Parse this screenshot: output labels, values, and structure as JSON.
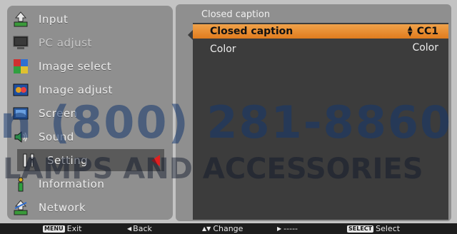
{
  "sidebar": {
    "items": [
      {
        "label": "Input",
        "icon": "input-icon"
      },
      {
        "label": "PC adjust",
        "icon": "pc-adjust-icon"
      },
      {
        "label": "Image select",
        "icon": "image-select-icon"
      },
      {
        "label": "Image adjust",
        "icon": "image-adjust-icon"
      },
      {
        "label": "Screen",
        "icon": "screen-icon"
      },
      {
        "label": "Sound",
        "icon": "sound-icon"
      },
      {
        "label": "Setting",
        "icon": "setting-icon"
      },
      {
        "label": "Information",
        "icon": "information-icon"
      },
      {
        "label": "Network",
        "icon": "network-icon"
      }
    ]
  },
  "panel": {
    "header": "Closed caption",
    "rows": [
      {
        "label": "Closed caption",
        "value": "CC1"
      },
      {
        "label": "Color",
        "value": "Color"
      }
    ]
  },
  "bottom_bar": {
    "exit_key": "MENU",
    "exit": "Exit",
    "back": "Back",
    "change": "Change",
    "next": "-----",
    "select_key": "SELECT",
    "select": "Select"
  },
  "watermark": {
    "phone": "n (800) 281-8860",
    "text": "LAMPS AND ACCESSORIES"
  },
  "colors": {
    "highlight": "#e8862a",
    "selection_arrow": "#e02020",
    "panel_gray": "#8f8f8f",
    "content_dark": "#3c3c3c"
  }
}
